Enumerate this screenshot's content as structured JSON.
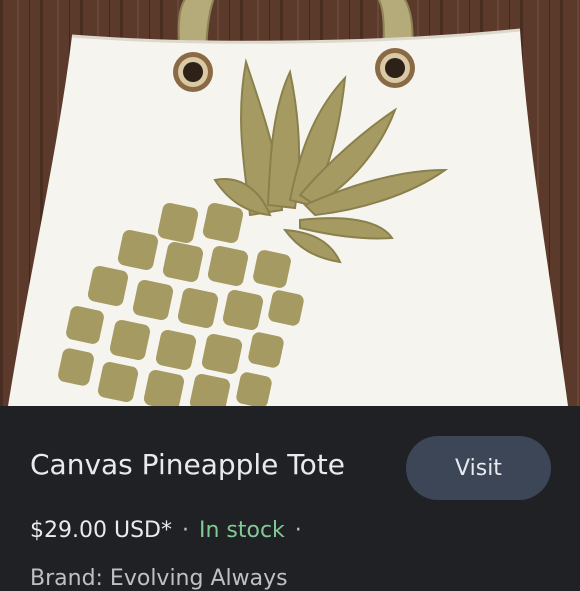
{
  "product": {
    "title": "Canvas Pineapple Tote",
    "visit_label": "Visit",
    "price": "$29.00 USD*",
    "separator": "·",
    "stock": "In stock",
    "brand_line": "Brand: Evolving Always"
  },
  "image": {
    "subject": "white canvas tote bag with gold pineapple print"
  },
  "colors": {
    "panel_bg": "#202124",
    "button_bg": "#3c4656",
    "stock_green": "#81c995",
    "text_primary": "#e8eaed",
    "pineapple_gold": "#a59a62"
  }
}
